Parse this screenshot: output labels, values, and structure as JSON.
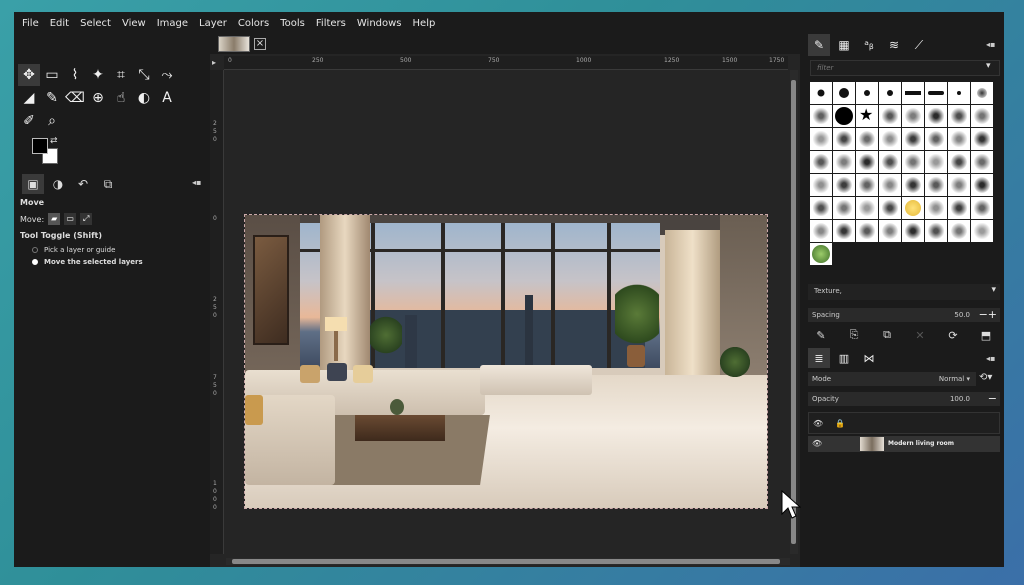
{
  "menu": [
    "File",
    "Edit",
    "Select",
    "View",
    "Image",
    "Layer",
    "Colors",
    "Tools",
    "Filters",
    "Windows",
    "Help"
  ],
  "toolbox": {
    "tools": [
      {
        "icon": "move-icon",
        "glyph": "✥",
        "selected": true
      },
      {
        "icon": "rect-select-icon",
        "glyph": "▭"
      },
      {
        "icon": "free-select-icon",
        "glyph": "⌇"
      },
      {
        "icon": "fuzzy-select-icon",
        "glyph": "✦"
      },
      {
        "icon": "crop-icon",
        "glyph": "⌗"
      },
      {
        "icon": "unified-transform-icon",
        "glyph": "⤡"
      },
      {
        "icon": "warp-transform-icon",
        "glyph": "⤳"
      },
      {
        "icon": "bucket-fill-icon",
        "glyph": "◢"
      },
      {
        "icon": "paintbrush-icon",
        "glyph": "✎"
      },
      {
        "icon": "eraser-icon",
        "glyph": "⌫"
      },
      {
        "icon": "clone-icon",
        "glyph": "⊕"
      },
      {
        "icon": "smudge-icon",
        "glyph": "☝"
      },
      {
        "icon": "dodge-burn-icon",
        "glyph": "◐"
      },
      {
        "icon": "text-icon",
        "glyph": "A"
      },
      {
        "icon": "color-picker-icon",
        "glyph": "✐"
      },
      {
        "icon": "zoom-icon",
        "glyph": "⌕"
      }
    ],
    "tool_options": {
      "title": "Move",
      "move_label": "Move:",
      "toggle_label": "Tool Toggle  (Shift)",
      "option_pick": "Pick a layer or guide",
      "option_move": "Move the selected layers"
    }
  },
  "ruler": {
    "top": [
      "0",
      "250",
      "500",
      "750",
      "1000",
      "1250",
      "1500",
      "1750"
    ],
    "left": [
      "2",
      "5",
      "0",
      "0",
      "2",
      "5",
      "0",
      "7",
      "5",
      "0",
      "1",
      "0",
      "0",
      "0"
    ]
  },
  "brushes": {
    "filter_placeholder": "filter",
    "texture_label": "Texture,",
    "spacing_label": "Spacing",
    "spacing_value": "50.0"
  },
  "layers": {
    "mode_label": "Mode",
    "mode_value": "Normal",
    "opacity_label": "Opacity",
    "opacity_value": "100.0",
    "layer_name": "Modern living room"
  },
  "colors": {
    "foreground": "#000000",
    "background": "#ffffff",
    "canvas_bg": "#252525",
    "desktop_gradient": "#3aa0a8"
  }
}
